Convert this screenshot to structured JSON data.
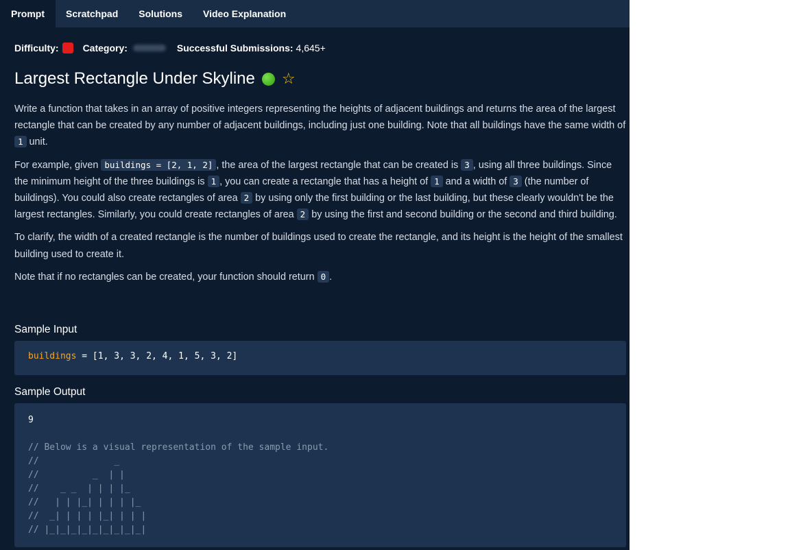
{
  "tabs": [
    {
      "label": "Prompt",
      "active": true
    },
    {
      "label": "Scratchpad"
    },
    {
      "label": "Solutions"
    },
    {
      "label": "Video Explanation"
    }
  ],
  "meta": {
    "difficulty_label": "Difficulty:",
    "difficulty_color": "#e51c1c",
    "category_label": "Category:",
    "submissions_label": "Successful Submissions:",
    "submissions_value": "4,645+"
  },
  "title": "Largest Rectangle Under Skyline",
  "p1": {
    "a": "Write a function that takes in an array of positive integers representing the heights of adjacent buildings and returns the area of the largest rectangle that can be created by any number of adjacent buildings, including just one building. Note that all buildings have the same width of ",
    "code": "1",
    "b": " unit."
  },
  "p2": {
    "a": "For example, given ",
    "c1": "buildings = [2, 1, 2]",
    "b": ", the area of the largest rectangle that can be created is ",
    "c2": "3",
    "c": ", using all three buildings. Since the minimum height of the three buildings is ",
    "c3": "1",
    "d": ", you can create a rectangle that has a height of ",
    "c4": "1",
    "e": " and a width of ",
    "c5": "3",
    "f": " (the number of buildings). You could also create rectangles of area ",
    "c6": "2",
    "g": " by using only the first building or the last building, but these clearly wouldn't be the largest rectangles. Similarly, you could create rectangles of area ",
    "c7": "2",
    "h": " by using the first and second building or the second and third building."
  },
  "p3": "To clarify, the width of a created rectangle is the number of buildings used to create the rectangle, and its height is the height of the smallest building used to create it.",
  "p4": {
    "a": "Note that if no rectangles can be created, your function should return ",
    "code": "0",
    "b": "."
  },
  "sample_input": {
    "heading": "Sample Input",
    "var": "buildings",
    "rest": " = [1, 3, 3, 2, 4, 1, 5, 3, 2]"
  },
  "sample_output": {
    "heading": "Sample Output",
    "value": "9",
    "lines": [
      "// Below is a visual representation of the sample input.",
      "//              _",
      "//          _  | |",
      "//    _ _  | | | |_",
      "//   | | |_| | | | |_",
      "//  _| | | | |_| | | |",
      "// |_|_|_|_|_|_|_|_|_|"
    ]
  },
  "colors": {
    "panel_bg": "#0d1b2e",
    "tab_bar": "#1a2d46",
    "code_bg": "#1d334f",
    "keyword": "#f5a623",
    "star": "#f5c518",
    "green_dot": "#4bc12a"
  }
}
